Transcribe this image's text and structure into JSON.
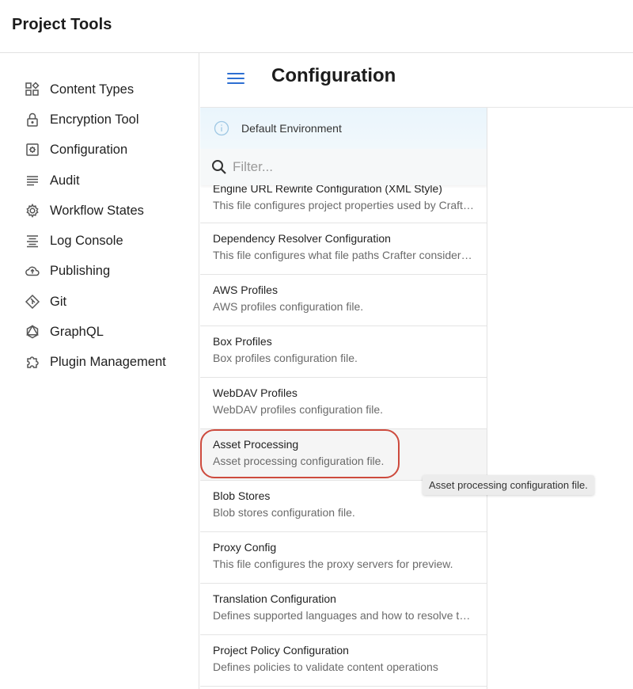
{
  "app": {
    "title": "Project Tools"
  },
  "sidebar": {
    "items": [
      {
        "label": "Content Types",
        "icon": "content-types-icon"
      },
      {
        "label": "Encryption Tool",
        "icon": "lock-icon"
      },
      {
        "label": "Configuration",
        "icon": "settings-box-icon"
      },
      {
        "label": "Audit",
        "icon": "lines-icon"
      },
      {
        "label": "Workflow States",
        "icon": "gear-icon"
      },
      {
        "label": "Log Console",
        "icon": "centered-lines-icon"
      },
      {
        "label": "Publishing",
        "icon": "cloud-upload-icon"
      },
      {
        "label": "Git",
        "icon": "git-icon"
      },
      {
        "label": "GraphQL",
        "icon": "graphql-icon"
      },
      {
        "label": "Plugin Management",
        "icon": "puzzle-icon"
      }
    ]
  },
  "header": {
    "title": "Configuration",
    "menu_icon": "hamburger-menu-icon"
  },
  "environment": {
    "label": "Default Environment",
    "icon": "info-icon"
  },
  "filter": {
    "placeholder": "Filter...",
    "value": ""
  },
  "config_files": [
    {
      "title": "Engine URL Rewrite Configuration (XML Style)",
      "description": "This file configures project properties used by Crafter CMS"
    },
    {
      "title": "Dependency Resolver Configuration",
      "description": "This file configures what file paths Crafter considers a dependency"
    },
    {
      "title": "AWS Profiles",
      "description": "AWS profiles configuration file."
    },
    {
      "title": "Box Profiles",
      "description": "Box profiles configuration file."
    },
    {
      "title": "WebDAV Profiles",
      "description": "WebDAV profiles configuration file."
    },
    {
      "title": "Asset Processing",
      "description": "Asset processing configuration file."
    },
    {
      "title": "Blob Stores",
      "description": "Blob stores configuration file."
    },
    {
      "title": "Proxy Config",
      "description": "This file configures the proxy servers for preview."
    },
    {
      "title": "Translation Configuration",
      "description": "Defines supported languages and how to resolve them"
    },
    {
      "title": "Project Policy Configuration",
      "description": "Defines policies to validate content operations"
    }
  ],
  "hovered_index": 5,
  "tooltip": {
    "text": "Asset processing configuration file."
  },
  "colors": {
    "accent": "#2d6fd2",
    "highlight_ring": "#cd4a3d",
    "banner_bg": "#eaf5fc"
  }
}
